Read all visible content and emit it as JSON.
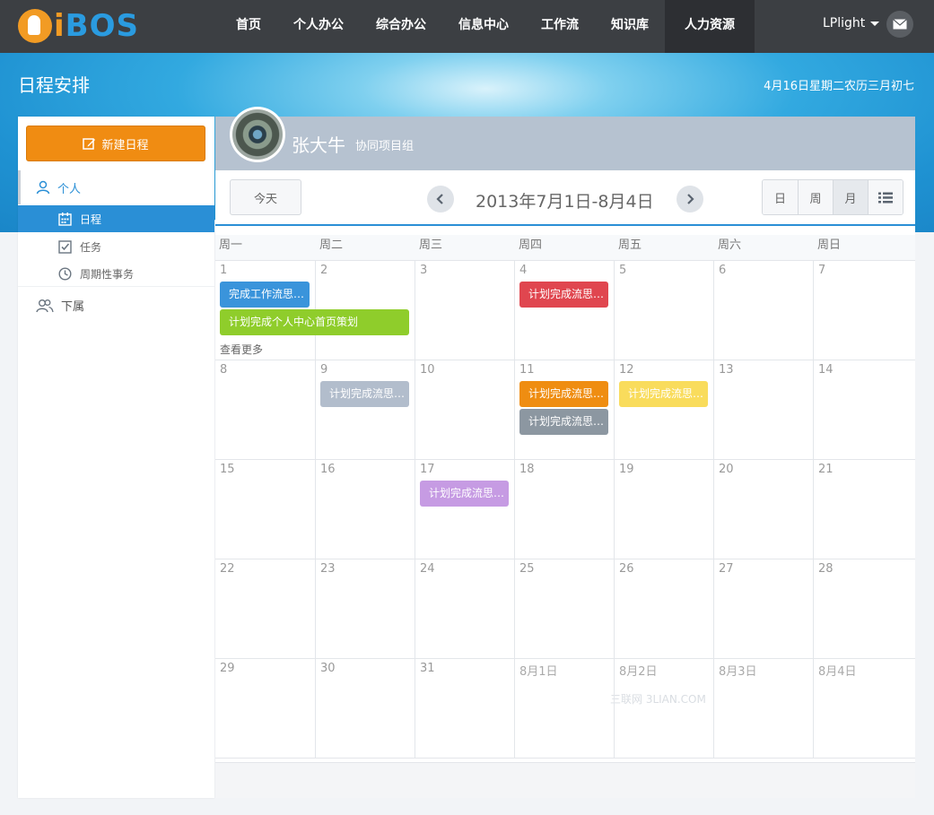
{
  "brand": {
    "logo_text_i": "i",
    "logo_text_rest": "BOS"
  },
  "nav": {
    "items": [
      {
        "label": "首页"
      },
      {
        "label": "个人办公"
      },
      {
        "label": "综合办公"
      },
      {
        "label": "信息中心"
      },
      {
        "label": "工作流"
      },
      {
        "label": "知识库"
      },
      {
        "label": "人力资源"
      }
    ],
    "active_index": 6
  },
  "user": {
    "name": "LPlight"
  },
  "header": {
    "title": "日程安排",
    "date_info": "4月16日星期二农历三月初七"
  },
  "sidebar": {
    "new_button": "新建日程",
    "personal": "个人",
    "items": [
      {
        "label": "日程",
        "icon": "calendar-icon"
      },
      {
        "label": "任务",
        "icon": "checkbox-icon"
      },
      {
        "label": "周期性事务",
        "icon": "clock-icon"
      }
    ],
    "subordinates": "下属"
  },
  "profile": {
    "name": "张大牛",
    "group": "协同项目组"
  },
  "toolbar": {
    "today": "今天",
    "range": "2013年7月1日-8月4日",
    "views": [
      "日",
      "周",
      "月"
    ],
    "active_view": "月"
  },
  "calendar": {
    "weekdays": [
      "周一",
      "周二",
      "周三",
      "周四",
      "周五",
      "周六",
      "周日"
    ],
    "weeks": [
      [
        "1",
        "2",
        "3",
        "4",
        "5",
        "6",
        "7"
      ],
      [
        "8",
        "9",
        "10",
        "11",
        "12",
        "13",
        "14"
      ],
      [
        "15",
        "16",
        "17",
        "18",
        "19",
        "20",
        "21"
      ],
      [
        "22",
        "23",
        "24",
        "25",
        "26",
        "27",
        "28"
      ],
      [
        "29",
        "30",
        "31",
        "8月1日",
        "8月2日",
        "8月3日",
        "8月4日"
      ]
    ],
    "events": [
      {
        "title": "完成工作流思…",
        "color": "#3a94db",
        "week": 0,
        "day": 0,
        "span": 1,
        "row": 0
      },
      {
        "title": "计划完成个人中心首页策划",
        "color": "#8fcd2b",
        "week": 0,
        "day": 0,
        "span": 2,
        "row": 1
      },
      {
        "title": "计划完成流思…",
        "color": "#e0464f",
        "week": 0,
        "day": 3,
        "span": 1,
        "row": 0
      },
      {
        "title": "计划完成流思…",
        "color": "#b2bdcc",
        "week": 1,
        "day": 1,
        "span": 1,
        "row": 0
      },
      {
        "title": "计划完成流思…",
        "color": "#ef8d11",
        "week": 1,
        "day": 3,
        "span": 1,
        "row": 0
      },
      {
        "title": "计划完成流思…",
        "color": "#8c97a1",
        "week": 1,
        "day": 3,
        "span": 1,
        "row": 1
      },
      {
        "title": "计划完成流思…",
        "color": "#f9dc5c",
        "week": 1,
        "day": 4,
        "span": 1,
        "row": 0
      },
      {
        "title": "计划完成流思…",
        "color": "#c69be3",
        "week": 2,
        "day": 2,
        "span": 1,
        "row": 0
      }
    ],
    "more_link": "查看更多",
    "watermark": "三联网 3LIAN.COM"
  }
}
